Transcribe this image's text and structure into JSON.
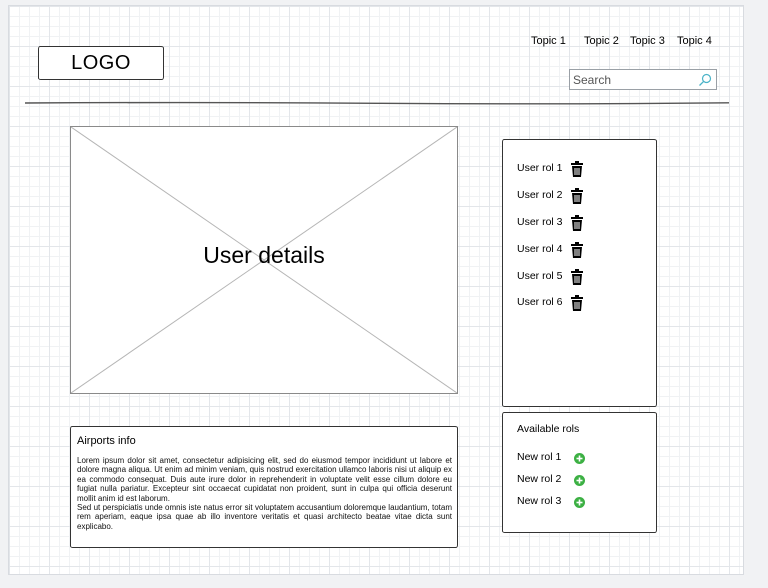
{
  "header": {
    "logo": "LOGO",
    "nav": [
      "Topic 1",
      "Topic 2",
      "Topic 3",
      "Topic 4"
    ],
    "search_placeholder": "Search"
  },
  "main": {
    "image_label": "User details"
  },
  "info": {
    "title": "Airports info",
    "paragraph1": "Lorem ipsum dolor sit amet, consectetur adipisicing elit, sed do eiusmod tempor incididunt ut labore et dolore magna aliqua. Ut enim ad minim veniam, quis nostrud exercitation ullamco laboris nisi ut aliquip ex ea commodo consequat. Duis aute irure dolor in reprehenderit in voluptate velit esse cillum dolore eu fugiat nulla pariatur. Excepteur sint occaecat cupidatat non proident, sunt in culpa qui officia deserunt mollit anim id est laborum.",
    "paragraph2": "Sed ut perspiciatis unde omnis iste natus error sit voluptatem accusantium doloremque laudantium, totam rem aperiam, eaque ipsa quae ab illo inventore veritatis et quasi architecto beatae vitae dicta sunt explicabo."
  },
  "roles": {
    "items": [
      "User rol 1",
      "User rol 2",
      "User rol 3",
      "User rol 4",
      "User rol 5",
      "User rol 6"
    ],
    "icon": "trash-icon"
  },
  "available": {
    "title": "Available rols",
    "items": [
      "New rol 1",
      "New rol 2",
      "New rol 3"
    ],
    "icon": "plus-circle-icon",
    "icon_color": "#3cb043"
  },
  "colors": {
    "search_icon": "#4ab3c8",
    "sketch_line": "#333333"
  }
}
